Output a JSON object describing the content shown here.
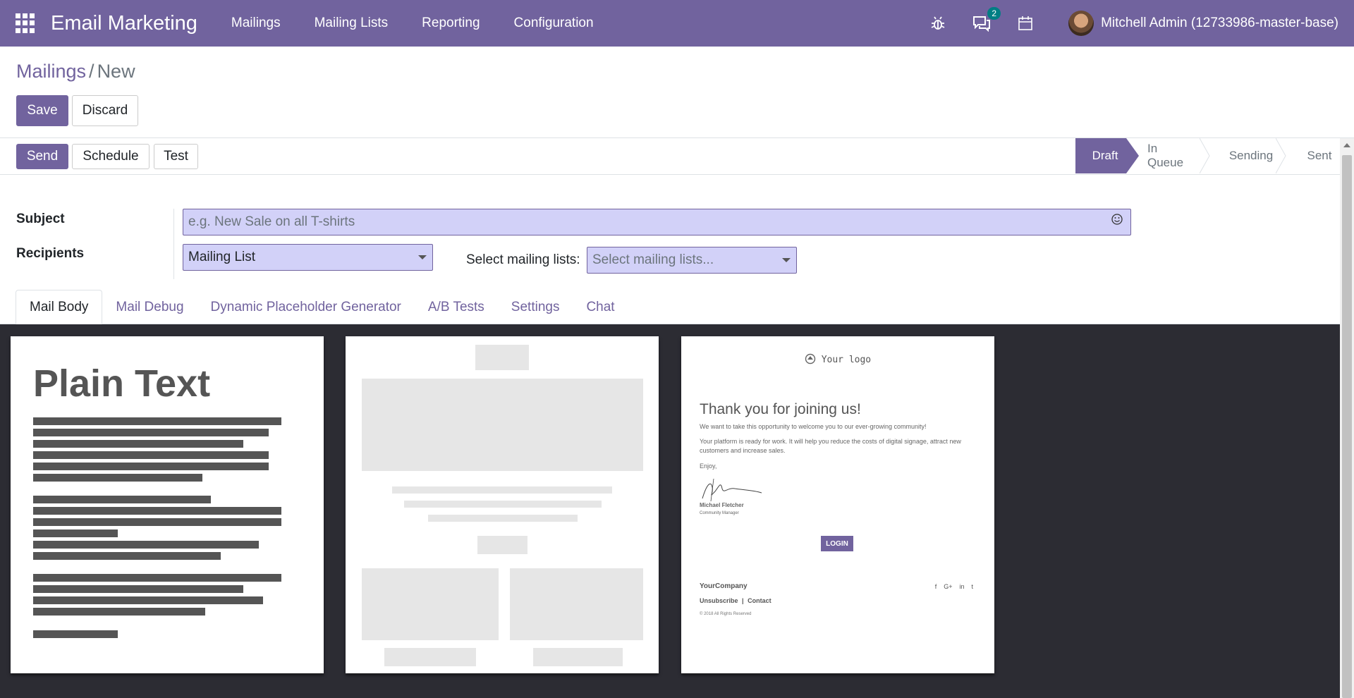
{
  "navbar": {
    "app_title": "Email Marketing",
    "menu": [
      "Mailings",
      "Mailing Lists",
      "Reporting",
      "Configuration"
    ],
    "message_count": "2",
    "user": "Mitchell Admin (12733986-master-base)",
    "accent_color": "#71639e"
  },
  "breadcrumb": {
    "parent": "Mailings",
    "separator": "/",
    "current": "New"
  },
  "actions": {
    "save": "Save",
    "discard": "Discard"
  },
  "statusbar": {
    "buttons": {
      "send": "Send",
      "schedule": "Schedule",
      "test": "Test"
    },
    "stages": [
      "Draft",
      "In Queue",
      "Sending",
      "Sent"
    ],
    "active_stage": "Draft"
  },
  "form": {
    "subject_label": "Subject",
    "subject_placeholder": "e.g. New Sale on all T-shirts",
    "recipients_label": "Recipients",
    "recipients_value": "Mailing List",
    "mailing_lists_label": "Select mailing lists:",
    "mailing_lists_placeholder": "Select mailing lists..."
  },
  "tabs": [
    "Mail Body",
    "Mail Debug",
    "Dynamic Placeholder Generator",
    "A/B Tests",
    "Settings",
    "Chat"
  ],
  "templates": {
    "plain_text_title": "Plain Text",
    "welcome": {
      "logo": "Your logo",
      "title": "Thank you for joining us!",
      "line1": "We want to take this opportunity to welcome you to our ever-growing community!",
      "line2": "Your platform is ready for work. It will help you reduce the costs of digital signage, attract new customers and increase sales.",
      "enjoy": "Enjoy,",
      "signer_name": "Michael Fletcher",
      "signer_role": "Community Manager",
      "login": "LOGIN",
      "company": "YourCompany",
      "unsubscribe": "Unsubscribe",
      "contact": "Contact",
      "copyright": "© 2018 All Rights Reserved",
      "social": [
        "f",
        "G+",
        "in",
        "t"
      ]
    }
  }
}
